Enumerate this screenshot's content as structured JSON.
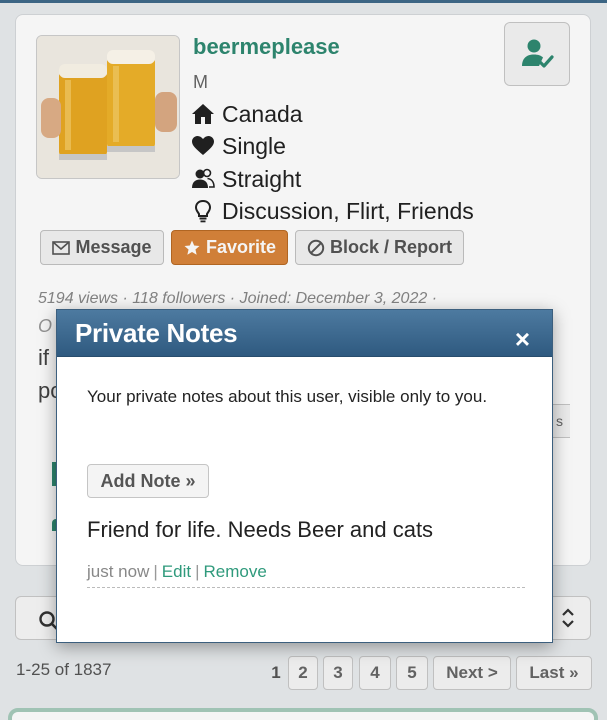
{
  "profile": {
    "username": "beermeplease",
    "gender": "M",
    "location": "Canada",
    "status": "Single",
    "orientation": "Straight",
    "looking_for": "Discussion, Flirt, Friends",
    "stats": "5194 views · 118 followers · Joined: December 3, 2022 ·"
  },
  "actions": {
    "message": "Message",
    "favorite": "Favorite",
    "block_report": "Block / Report"
  },
  "background_fragments": {
    "line1": "O",
    "line2": "if",
    "line3": "pc"
  },
  "pagination": {
    "range": "1-25 of 1837",
    "pages": [
      "1",
      "2",
      "3",
      "4",
      "5"
    ],
    "next": "Next >",
    "last": "Last »"
  },
  "modal": {
    "title": "Private Notes",
    "close": "×",
    "description": "Your private notes about this user, visible only to you.",
    "add_note": "Add Note »",
    "note_text": "Friend for life. Needs Beer and cats",
    "timestamp": "just now",
    "edit": "Edit",
    "remove": "Remove"
  },
  "colors": {
    "brand_green": "#2f8a72",
    "favorite_orange": "#d9853b",
    "modal_header": "#3f6a8a"
  }
}
